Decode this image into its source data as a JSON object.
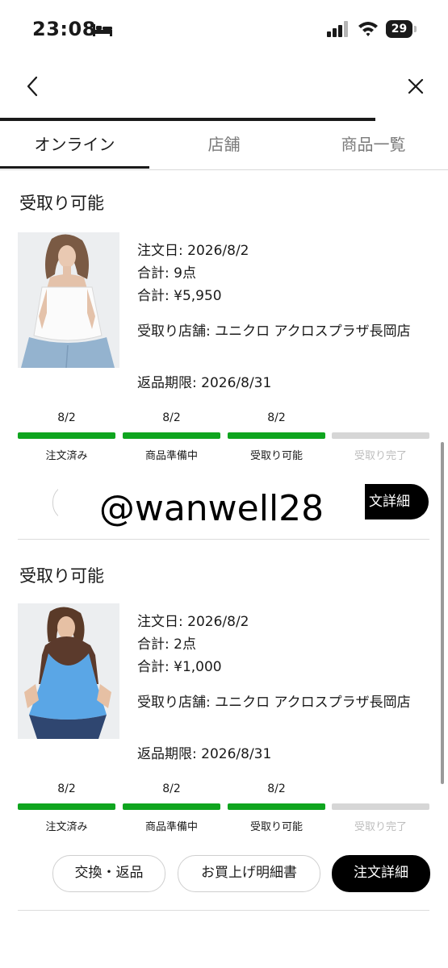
{
  "status_bar": {
    "time": "23:08",
    "battery": "29",
    "icons": [
      "bed-icon",
      "signal-icon",
      "wifi-icon",
      "battery-icon"
    ]
  },
  "nav": {
    "back_icon": "chevron-left-icon",
    "close_icon": "close-icon"
  },
  "tabs": [
    {
      "label": "オンライン",
      "active": true
    },
    {
      "label": "店舗",
      "active": false
    },
    {
      "label": "商品一覧",
      "active": false
    }
  ],
  "orders": [
    {
      "status_title": "受取り可能",
      "order_date": "注文日: 2026/8/2",
      "total_items": "合計: 9点",
      "total_price": "合計: ¥5,950",
      "store": "受取り店舗: ユニクロ アクロスプラザ長岡店",
      "return_deadline": "返品期限: 2026/8/31",
      "image": "white-camisole-top-photo",
      "steps": [
        {
          "date": "8/2",
          "label": "注文済み",
          "done": true
        },
        {
          "date": "8/2",
          "label": "商品準備中",
          "done": true
        },
        {
          "date": "8/2",
          "label": "受取り可能",
          "done": true
        },
        {
          "date": "",
          "label": "受取り完了",
          "done": false
        }
      ],
      "buttons": {
        "detail": "文詳細"
      }
    },
    {
      "status_title": "受取り可能",
      "order_date": "注文日: 2026/8/2",
      "total_items": "合計: 2点",
      "total_price": "合計: ¥1,000",
      "store": "受取り店舗: ユニクロ アクロスプラザ長岡店",
      "return_deadline": "返品期限: 2026/8/31",
      "image": "blue-camisole-top-photo",
      "steps": [
        {
          "date": "8/2",
          "label": "注文済み",
          "done": true
        },
        {
          "date": "8/2",
          "label": "商品準備中",
          "done": true
        },
        {
          "date": "8/2",
          "label": "受取り可能",
          "done": true
        },
        {
          "date": "",
          "label": "受取り完了",
          "done": false
        }
      ],
      "buttons": {
        "exchange": "交換・返品",
        "receipt": "お買上げ明細書",
        "detail": "注文詳細"
      }
    }
  ],
  "watermark": "@wanwell28",
  "colors": {
    "done": "#0fa51f",
    "pending": "#d6d6d6",
    "pending_text": "#bdbdbd",
    "accent": "#000000"
  }
}
